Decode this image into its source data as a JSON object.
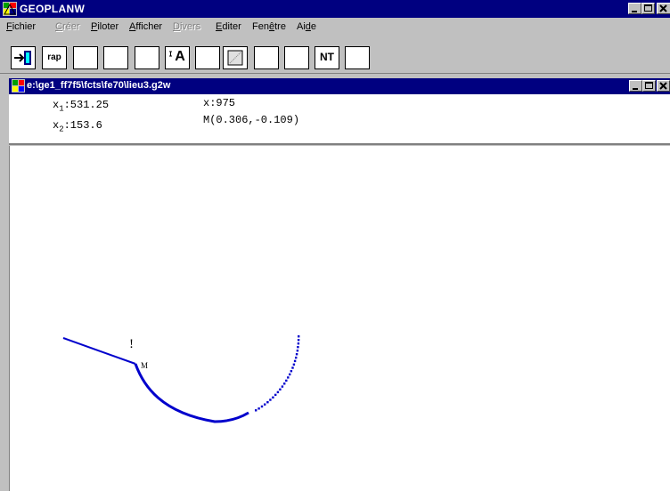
{
  "app": {
    "title": "GEOPLANW"
  },
  "menu": {
    "items": [
      {
        "label": "Fichier",
        "ul": "F",
        "rest": "ichier",
        "enabled": true
      },
      {
        "label": "Créer",
        "ul": "C",
        "rest": "réer",
        "enabled": false
      },
      {
        "label": "Piloter",
        "ul": "P",
        "rest": "iloter",
        "enabled": true
      },
      {
        "label": "Afficher",
        "ul": "A",
        "rest": "fficher",
        "enabled": true
      },
      {
        "label": "Divers",
        "ul": "D",
        "rest": "ivers",
        "enabled": false
      },
      {
        "label": "Editer",
        "ul": "E",
        "rest": "diter",
        "enabled": true
      },
      {
        "label": "Fenêtre",
        "pre": "Fen",
        "ul": "ê",
        "rest": "tre",
        "enabled": true
      },
      {
        "label": "Aide",
        "pre": "Ai",
        "ul": "d",
        "rest": "e",
        "enabled": true
      }
    ]
  },
  "toolbar": {
    "rap_label": "rap",
    "text_tool_label": "A",
    "name_tool_label": "NT"
  },
  "document": {
    "title": "e:\\ge1_ff7f5\\fcts\\fe70\\lieu3.g2w"
  },
  "info": {
    "x1_prefix": "x",
    "x1_sub": "1",
    "x1_value": ":531.25",
    "x2_prefix": "x",
    "x2_sub": "2",
    "x2_value": ":153.6",
    "x_value": "x:975",
    "m_value": "M(0.306,-0.109)"
  },
  "canvas": {
    "point_label": "M",
    "excl_label": "!",
    "curve_color": "#0000cc"
  }
}
